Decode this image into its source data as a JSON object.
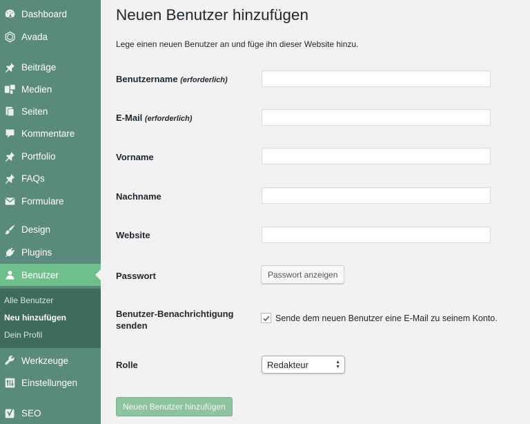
{
  "sidebar": {
    "items": [
      {
        "label": "Dashboard",
        "icon": "dashboard-icon"
      },
      {
        "label": "Avada",
        "icon": "avada-icon"
      },
      {
        "label": "Beiträge",
        "icon": "pin-icon"
      },
      {
        "label": "Medien",
        "icon": "media-icon"
      },
      {
        "label": "Seiten",
        "icon": "pages-icon"
      },
      {
        "label": "Kommentare",
        "icon": "comment-icon"
      },
      {
        "label": "Portfolio",
        "icon": "pin-icon"
      },
      {
        "label": "FAQs",
        "icon": "pin-icon"
      },
      {
        "label": "Formulare",
        "icon": "mail-icon"
      },
      {
        "label": "Design",
        "icon": "brush-icon"
      },
      {
        "label": "Plugins",
        "icon": "plugin-icon"
      },
      {
        "label": "Benutzer",
        "icon": "user-icon",
        "active": true
      },
      {
        "label": "Werkzeuge",
        "icon": "wrench-icon"
      },
      {
        "label": "Einstellungen",
        "icon": "settings-icon"
      },
      {
        "label": "SEO",
        "icon": "seo-icon"
      }
    ],
    "submenu": [
      {
        "label": "Alle Benutzer"
      },
      {
        "label": "Neu hinzufügen",
        "current": true
      },
      {
        "label": "Dein Profil"
      }
    ],
    "colors": {
      "background": "#5a8a7c",
      "active": "#6fbf8b",
      "submenu": "#3f6b5e"
    }
  },
  "page": {
    "title": "Neuen Benutzer hinzufügen",
    "description": "Lege einen neuen Benutzer an und füge ihn dieser Website hinzu."
  },
  "form": {
    "username": {
      "label": "Benutzername",
      "required": "(erforderlich)",
      "value": ""
    },
    "email": {
      "label": "E-Mail",
      "required": "(erforderlich)",
      "value": ""
    },
    "firstname": {
      "label": "Vorname",
      "value": ""
    },
    "lastname": {
      "label": "Nachname",
      "value": ""
    },
    "website": {
      "label": "Website",
      "value": ""
    },
    "password": {
      "label": "Passwort",
      "button": "Passwort anzeigen"
    },
    "notify": {
      "label_line1": "Benutzer-Benachrichtigung",
      "label_line2": "senden",
      "checked": true,
      "text": "Sende dem neuen Benutzer eine E-Mail zu seinem Konto."
    },
    "role": {
      "label": "Rolle",
      "selected": "Redakteur"
    },
    "submit": "Neuen Benutzer hinzufügen"
  }
}
